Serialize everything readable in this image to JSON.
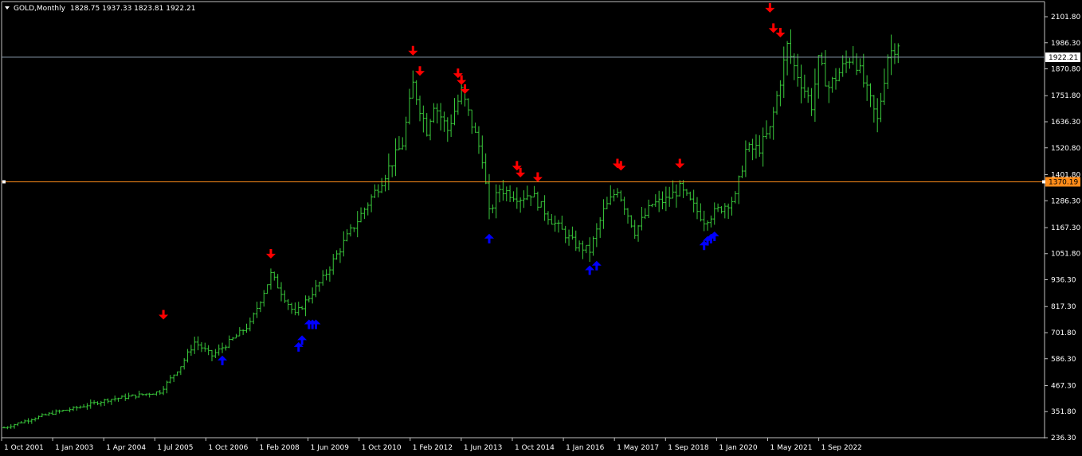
{
  "symbol_title": "GOLD,Monthly",
  "ohlc_readout": "1828.75 1937.33 1823.81 1922.21",
  "colors": {
    "background": "#000000",
    "bars": "#39c93b",
    "frame": "#c0c0c0",
    "current_price_line": "#8c9eb0",
    "level_line": "#ff8c1a",
    "sell_arrow": "#ff0000",
    "buy_arrow": "#0000ff"
  },
  "chart_data": {
    "type": "ohlc",
    "x_tick_labels": [
      "1 Oct 2001",
      "1 Jan 2003",
      "1 Apr 2004",
      "1 Jul 2005",
      "1 Oct 2006",
      "1 Feb 2008",
      "1 Jun 2009",
      "1 Oct 2010",
      "1 Feb 2012",
      "1 Jun 2013",
      "1 Oct 2014",
      "1 Jan 2016",
      "1 May 2017",
      "1 Sep 2018",
      "1 Jan 2020",
      "1 May 2021",
      "1 Sep 2022"
    ],
    "y_tick_labels": [
      "2101.80",
      "1986.30",
      "1870.80",
      "1751.80",
      "1636.30",
      "1520.80",
      "1401.80",
      "1286.30",
      "1167.30",
      "1051.80",
      "936.30",
      "817.30",
      "701.80",
      "586.30",
      "467.30",
      "351.80",
      "236.30"
    ],
    "ylim": [
      236.3,
      2101.8
    ],
    "current_price": 1922.21,
    "current_price_label": "1922.21",
    "level_price": 1370.19,
    "level_label": "1370.19",
    "anchors": [
      [
        "2001-10",
        280
      ],
      [
        "2002-06",
        320
      ],
      [
        "2003-01",
        350
      ],
      [
        "2003-06",
        365
      ],
      [
        "2004-04",
        405
      ],
      [
        "2005-01",
        425
      ],
      [
        "2005-07",
        440
      ],
      [
        "2006-01",
        555
      ],
      [
        "2006-05",
        660
      ],
      [
        "2006-10",
        600
      ],
      [
        "2007-03",
        660
      ],
      [
        "2007-09",
        740
      ],
      [
        "2008-02",
        920
      ],
      [
        "2008-03",
        960
      ],
      [
        "2008-10",
        780
      ],
      [
        "2009-06",
        940
      ],
      [
        "2009-12",
        1100
      ],
      [
        "2010-10",
        1350
      ],
      [
        "2011-05",
        1540
      ],
      [
        "2011-08",
        1800
      ],
      [
        "2011-12",
        1600
      ],
      [
        "2012-02",
        1720
      ],
      [
        "2012-06",
        1600
      ],
      [
        "2012-10",
        1770
      ],
      [
        "2013-04",
        1480
      ],
      [
        "2013-06",
        1230
      ],
      [
        "2013-09",
        1340
      ],
      [
        "2014-03",
        1300
      ],
      [
        "2014-06",
        1320
      ],
      [
        "2014-12",
        1200
      ],
      [
        "2015-07",
        1090
      ],
      [
        "2015-11",
        1065
      ],
      [
        "2016-03",
        1240
      ],
      [
        "2016-07",
        1340
      ],
      [
        "2016-12",
        1150
      ],
      [
        "2017-05",
        1270
      ],
      [
        "2017-09",
        1290
      ],
      [
        "2018-01",
        1340
      ],
      [
        "2018-08",
        1200
      ],
      [
        "2019-05",
        1300
      ],
      [
        "2019-08",
        1510
      ],
      [
        "2019-12",
        1520
      ],
      [
        "2020-03",
        1600
      ],
      [
        "2020-08",
        1970
      ],
      [
        "2020-10",
        1880
      ],
      [
        "2021-03",
        1710
      ],
      [
        "2021-05",
        1900
      ],
      [
        "2021-08",
        1790
      ],
      [
        "2022-03",
        1940
      ],
      [
        "2022-06",
        1810
      ],
      [
        "2022-10",
        1640
      ],
      [
        "2023-01",
        1930
      ],
      [
        "2023-04",
        1990
      ]
    ],
    "sell_signals": [
      [
        "2005-08",
        760
      ],
      [
        "2008-03",
        1030
      ],
      [
        "2011-08",
        1930
      ],
      [
        "2011-10",
        1840
      ],
      [
        "2012-09",
        1830
      ],
      [
        "2012-10",
        1800
      ],
      [
        "2012-11",
        1760
      ],
      [
        "2014-02",
        1420
      ],
      [
        "2014-03",
        1390
      ],
      [
        "2014-08",
        1370
      ],
      [
        "2016-07",
        1430
      ],
      [
        "2016-08",
        1420
      ],
      [
        "2018-01",
        1430
      ],
      [
        "2020-03",
        2120
      ],
      [
        "2020-04",
        2030
      ],
      [
        "2020-06",
        2010
      ]
    ],
    "buy_signals": [
      [
        "2007-01",
        600
      ],
      [
        "2008-11",
        660
      ],
      [
        "2008-12",
        690
      ],
      [
        "2009-02",
        760
      ],
      [
        "2009-03",
        760
      ],
      [
        "2009-04",
        760
      ],
      [
        "2013-06",
        1140
      ],
      [
        "2015-11",
        1000
      ],
      [
        "2016-01",
        1020
      ],
      [
        "2018-08",
        1110
      ],
      [
        "2018-09",
        1130
      ],
      [
        "2018-10",
        1140
      ],
      [
        "2018-11",
        1150
      ]
    ]
  }
}
